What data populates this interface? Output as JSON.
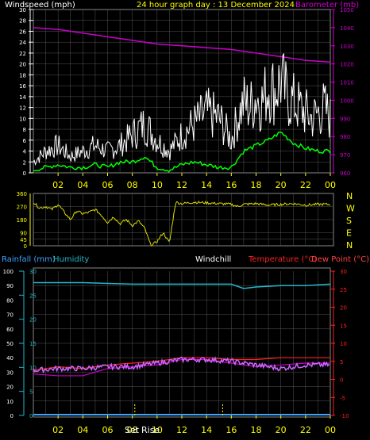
{
  "colors": {
    "background": "#000000",
    "plot_bg": "#000000",
    "grid": "#555555",
    "axis_white": "#ffffff",
    "header_yellow": "#ffff00",
    "baro_magenta": "#cc00cc",
    "wind_white": "#ffffff",
    "gust_green": "#00ff00",
    "dir_yellow": "#dddd00",
    "humidity_cyan": "#22b7cc",
    "rain_blue": "#3ea3ff",
    "temp_red": "#ff2020",
    "dew_red": "#ff4040",
    "windchill_purple": "#cc66ff"
  },
  "chart_data": [
    {
      "type": "line",
      "title": "24 hour graph day : 13 December 2024",
      "ylabel": "Windspeed (mph)",
      "y2label": "Barometer (mb)",
      "ylim": [
        0,
        30
      ],
      "y_ticks": [
        "0",
        "2",
        "4",
        "6",
        "8",
        "10",
        "12",
        "14",
        "16",
        "18",
        "20",
        "22",
        "24",
        "26",
        "28",
        "30"
      ],
      "y2lim": [
        960,
        1050
      ],
      "y2_ticks": [
        "960",
        "970",
        "980",
        "990",
        "1000",
        "1010",
        "1020",
        "1030",
        "1040",
        "1050"
      ],
      "x_ticks": [
        "02",
        "04",
        "06",
        "08",
        "10",
        "12",
        "14",
        "16",
        "18",
        "20",
        "22",
        "00"
      ],
      "grid": true,
      "series": [
        {
          "kind": "barometer",
          "x": [
            0,
            2,
            4,
            6,
            8,
            10,
            12,
            14,
            16,
            18,
            20,
            22,
            24
          ],
          "values": [
            1040,
            1039,
            1037,
            1035,
            1033,
            1031,
            1030,
            1029,
            1028,
            1026,
            1024,
            1022,
            1021
          ]
        },
        {
          "kind": "wind_gust",
          "x": [
            0,
            1,
            2,
            3,
            4,
            5,
            6,
            7,
            8,
            9,
            10,
            11,
            12,
            13,
            14,
            15,
            16,
            16.5,
            17,
            17.5,
            18,
            18.5,
            19,
            19.5,
            20,
            20.5,
            21,
            21.5,
            22,
            22.5,
            23,
            23.5,
            24
          ],
          "values": [
            2,
            4,
            5,
            3,
            4,
            5,
            4,
            5,
            7,
            9,
            6,
            4,
            7,
            9,
            11,
            10,
            6,
            10,
            13,
            12,
            14,
            13,
            16,
            15,
            17,
            14,
            13,
            12,
            11,
            10,
            11,
            12,
            10
          ]
        },
        {
          "kind": "wind_average",
          "x": [
            0,
            1,
            2,
            3,
            4,
            5,
            6,
            7,
            8,
            9,
            10,
            11,
            12,
            13,
            14,
            15,
            16,
            17,
            18,
            19,
            20,
            21,
            22,
            23,
            24
          ],
          "values": [
            0.5,
            1,
            1.5,
            1,
            1,
            1.5,
            1,
            2,
            2,
            3,
            1,
            0.5,
            1.5,
            2,
            1.5,
            1,
            1,
            4,
            5,
            6,
            7.5,
            5.5,
            4.5,
            4,
            4
          ]
        }
      ]
    },
    {
      "type": "line",
      "ylim": [
        0,
        360
      ],
      "y_ticks": [
        "0",
        "45",
        "90",
        "180",
        "270",
        "360"
      ],
      "right_labels": [
        "N",
        "W",
        "S",
        "E",
        "N"
      ],
      "x_ticks": [
        "02",
        "04",
        "06",
        "08",
        "10",
        "12",
        "14",
        "16",
        "18",
        "20",
        "22",
        "00"
      ],
      "series": [
        {
          "kind": "wind_direction",
          "x": [
            0,
            0.5,
            1,
            1.5,
            2,
            2.5,
            3,
            3.5,
            4,
            4.5,
            5,
            5.5,
            6,
            6.5,
            7,
            7.5,
            8,
            8.5,
            9,
            9.5,
            10,
            10.5,
            11,
            11.5,
            12,
            13,
            14,
            15,
            16,
            16.5,
            17,
            18,
            19,
            20,
            21,
            22,
            23,
            24
          ],
          "values": [
            300,
            260,
            270,
            250,
            285,
            230,
            180,
            240,
            220,
            230,
            250,
            210,
            160,
            200,
            150,
            180,
            140,
            170,
            120,
            0,
            30,
            90,
            20,
            300,
            290,
            300,
            295,
            290,
            285,
            270,
            285,
            290,
            280,
            285,
            290,
            280,
            285,
            285
          ]
        }
      ]
    },
    {
      "type": "line",
      "labels": [
        "Rainfall (mm)",
        "Humidity",
        "Windchill",
        "Temperature (°C)",
        "Dew Point (°C)"
      ],
      "ylim": [
        0,
        100
      ],
      "y_ticks": [
        "0",
        "10",
        "20",
        "30",
        "40",
        "50",
        "60",
        "70",
        "80",
        "90",
        "100"
      ],
      "y_rain_ticks": [
        "0",
        "5",
        "10",
        "15",
        "20",
        "25",
        "30"
      ],
      "y2lim": [
        -10,
        30
      ],
      "y2_ticks": [
        "-10",
        "-5",
        "0",
        "5",
        "10",
        "15",
        "20",
        "25",
        "30"
      ],
      "x_ticks": [
        "02",
        "04",
        "06",
        "08",
        "10",
        "12",
        "14",
        "16",
        "18",
        "20",
        "22",
        "00"
      ],
      "sun_labels": [
        "Set",
        "Rise"
      ],
      "series": [
        {
          "kind": "humidity",
          "x": [
            0,
            4,
            8,
            12,
            16,
            17,
            18,
            20,
            22,
            24
          ],
          "values": [
            92,
            92,
            91,
            91,
            91,
            88,
            89,
            90,
            90,
            91
          ]
        },
        {
          "kind": "rainfall",
          "x": [
            0,
            24
          ],
          "values": [
            0,
            0
          ]
        },
        {
          "kind": "temperature",
          "x": [
            0,
            2,
            4,
            6,
            8,
            10,
            12,
            14,
            16,
            18,
            20,
            22,
            24
          ],
          "values": [
            2.5,
            3.5,
            3.0,
            4.0,
            4.5,
            5.0,
            6.0,
            6.0,
            5.5,
            5.5,
            6.0,
            6.0,
            6.0
          ]
        },
        {
          "kind": "dew_point",
          "x": [
            0,
            2,
            4,
            6,
            8,
            10,
            12,
            14,
            16,
            18,
            20,
            22,
            24
          ],
          "values": [
            1.5,
            1.0,
            1.0,
            3.0,
            3.5,
            4.0,
            5.5,
            5.5,
            4.5,
            3.5,
            4.0,
            4.5,
            4.5
          ]
        },
        {
          "kind": "windchill",
          "x": [
            0,
            2,
            4,
            6,
            8,
            10,
            12,
            14,
            16,
            18,
            20,
            22,
            24
          ],
          "values": [
            2.5,
            3.0,
            3.0,
            3.5,
            3.5,
            4.5,
            5.5,
            5.5,
            5.0,
            4.0,
            3.0,
            4.0,
            4.0
          ]
        }
      ]
    }
  ]
}
